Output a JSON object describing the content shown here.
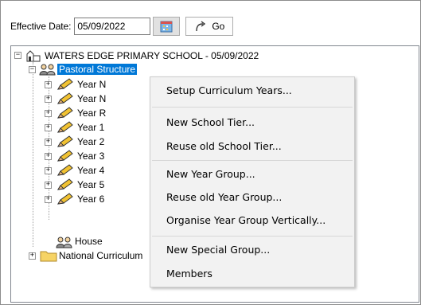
{
  "toolbar": {
    "effective_label": "Effective Date:",
    "date_value": "05/09/2022",
    "go_label": "Go"
  },
  "tree": {
    "root": "WATERS EDGE PRIMARY SCHOOL - 05/09/2022",
    "pastoral": "Pastoral Structure",
    "years": [
      "Year N",
      "Year N",
      "Year R",
      "Year 1",
      "Year 2",
      "Year 3",
      "Year 4",
      "Year 5",
      "Year 6"
    ],
    "house": "House",
    "national": "National Curriculum"
  },
  "menu": {
    "items": [
      "Setup Curriculum Years...",
      "New School Tier...",
      "Reuse old School Tier...",
      "New Year Group...",
      "Reuse old Year Group...",
      "Organise Year Group Vertically...",
      "New Special Group...",
      "Members"
    ]
  }
}
